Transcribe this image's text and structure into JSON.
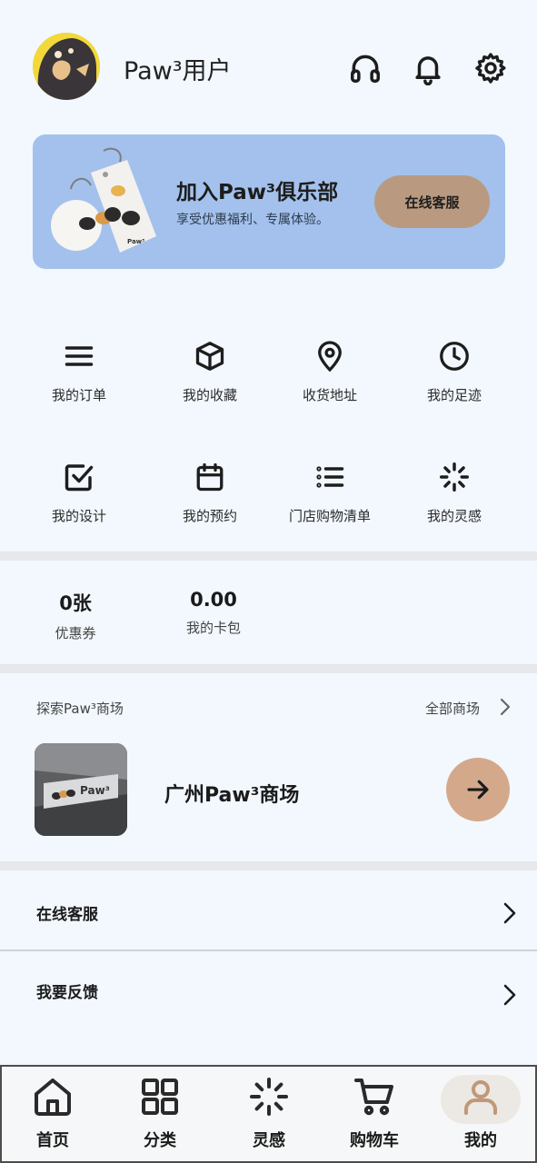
{
  "header": {
    "username": "Paw³用户",
    "icons": [
      "headset-icon",
      "bell-icon",
      "settings-icon"
    ]
  },
  "banner": {
    "title": "加入Paw³俱乐部",
    "subtitle": "享受优惠福利、专属体验。",
    "button_label": "在线客服",
    "tag_text": "Paw³"
  },
  "grid": [
    {
      "label": "我的订单",
      "icon": "menu-icon"
    },
    {
      "label": "我的收藏",
      "icon": "box-icon"
    },
    {
      "label": "收货地址",
      "icon": "location-pin-icon"
    },
    {
      "label": "我的足迹",
      "icon": "clock-icon"
    },
    {
      "label": "我的设计",
      "icon": "checkbox-icon"
    },
    {
      "label": "我的预约",
      "icon": "calendar-icon"
    },
    {
      "label": "门店购物清单",
      "icon": "list-icon"
    },
    {
      "label": "我的灵感",
      "icon": "loader-icon"
    }
  ],
  "stats": [
    {
      "value": "0张",
      "label": "优惠券"
    },
    {
      "value": "0.00",
      "label": "我的卡包"
    }
  ],
  "explore": {
    "title": "探索Paw³商场",
    "all_label": "全部商场",
    "mall_name": "广州Paw³商场",
    "sign_text": "Paw³"
  },
  "rows": [
    {
      "label": "在线客服"
    },
    {
      "label": "我要反馈"
    }
  ],
  "nav": [
    {
      "label": "首页",
      "icon": "home-icon"
    },
    {
      "label": "分类",
      "icon": "grid-icon"
    },
    {
      "label": "灵感",
      "icon": "sparkle-loader-icon"
    },
    {
      "label": "购物车",
      "icon": "cart-icon"
    },
    {
      "label": "我的",
      "icon": "user-icon",
      "active": true
    }
  ],
  "colors": {
    "background": "#f2f8fd",
    "banner": "#a3c1ec",
    "accent_button": "#b99a80",
    "mall_go": "#d4a98b",
    "active_user_icon": "#c09878"
  }
}
